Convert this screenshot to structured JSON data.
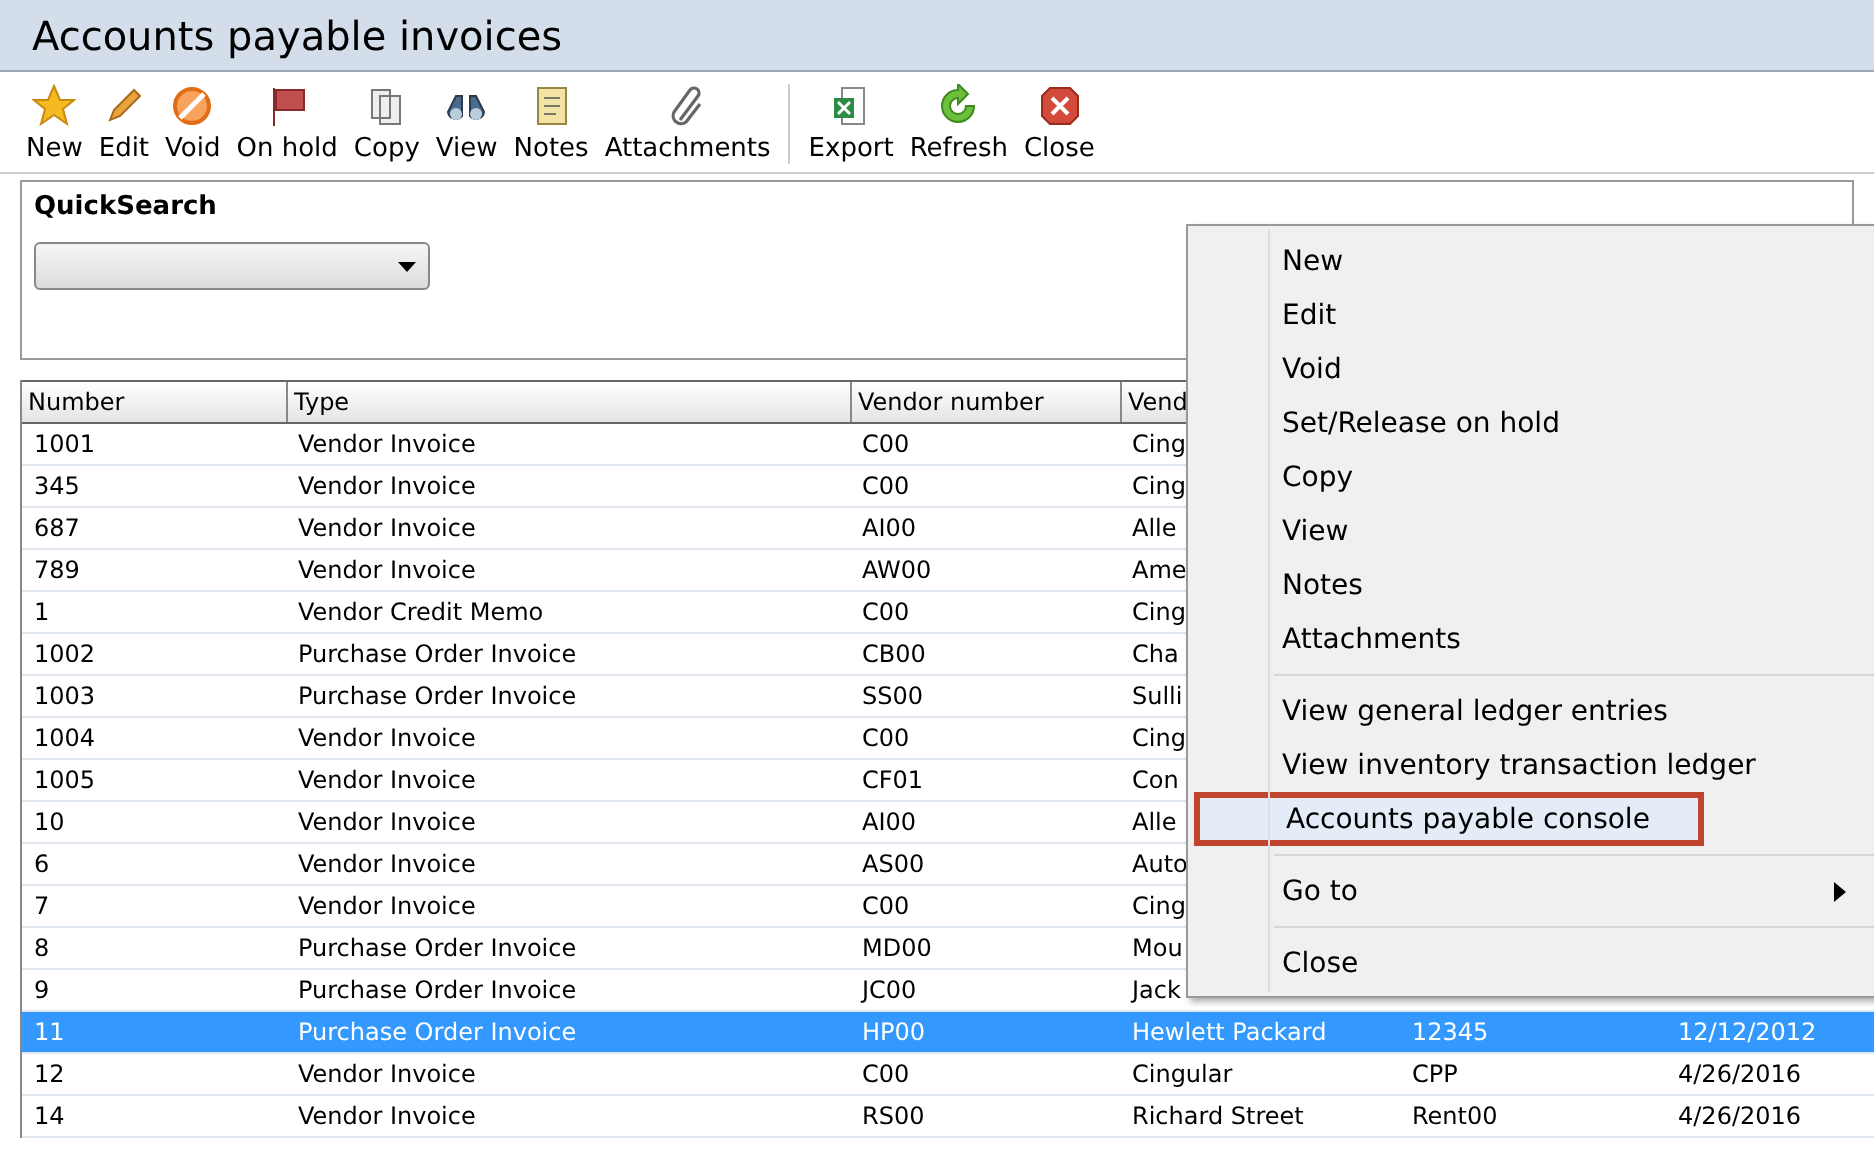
{
  "window": {
    "title": "Accounts payable invoices"
  },
  "toolbar": {
    "groups": [
      [
        {
          "label": "New",
          "kind": "star"
        },
        {
          "label": "Edit",
          "kind": "pencil"
        },
        {
          "label": "Void",
          "kind": "void"
        },
        {
          "label": "On hold",
          "kind": "flag"
        },
        {
          "label": "Copy",
          "kind": "copy"
        },
        {
          "label": "View",
          "kind": "binoculars"
        },
        {
          "label": "Notes",
          "kind": "notes"
        },
        {
          "label": "Attachments",
          "kind": "clip"
        }
      ],
      [
        {
          "label": "Export",
          "kind": "sheet"
        },
        {
          "label": "Refresh",
          "kind": "refresh"
        },
        {
          "label": "Close",
          "kind": "close"
        }
      ]
    ]
  },
  "quick_search": {
    "label": "QuickSearch"
  },
  "table": {
    "columns": [
      "Number",
      "Type",
      "Vendor number",
      "Vend"
    ],
    "rows": [
      {
        "selected": false,
        "cells": [
          "1001",
          "Vendor Invoice",
          "C00",
          "Cing"
        ]
      },
      {
        "selected": false,
        "cells": [
          "345",
          "Vendor Invoice",
          "C00",
          "Cing"
        ]
      },
      {
        "selected": false,
        "cells": [
          "687",
          "Vendor Invoice",
          "AI00",
          "Alle"
        ]
      },
      {
        "selected": false,
        "cells": [
          "789",
          "Vendor Invoice",
          "AW00",
          "Ame"
        ]
      },
      {
        "selected": false,
        "cells": [
          "1",
          "Vendor Credit Memo",
          "C00",
          "Cing"
        ]
      },
      {
        "selected": false,
        "cells": [
          "1002",
          "Purchase Order Invoice",
          "CB00",
          "Cha"
        ]
      },
      {
        "selected": false,
        "cells": [
          "1003",
          "Purchase Order Invoice",
          "SS00",
          "Sulli"
        ]
      },
      {
        "selected": false,
        "cells": [
          "1004",
          "Vendor Invoice",
          "C00",
          "Cing"
        ]
      },
      {
        "selected": false,
        "cells": [
          "1005",
          "Vendor Invoice",
          "CF01",
          "Con"
        ]
      },
      {
        "selected": false,
        "cells": [
          "10",
          "Vendor Invoice",
          "AI00",
          "Alle"
        ]
      },
      {
        "selected": false,
        "cells": [
          "6",
          "Vendor Invoice",
          "AS00",
          "Auto"
        ]
      },
      {
        "selected": false,
        "cells": [
          "7",
          "Vendor Invoice",
          "C00",
          "Cing"
        ]
      },
      {
        "selected": false,
        "cells": [
          "8",
          "Purchase Order Invoice",
          "MD00",
          "Mou"
        ]
      },
      {
        "selected": false,
        "cells": [
          "9",
          "Purchase Order Invoice",
          "JC00",
          "Jack"
        ]
      },
      {
        "selected": true,
        "cells": [
          "11",
          "Purchase Order Invoice",
          "HP00",
          "Hewlett Packard",
          "12345",
          "12/12/2012"
        ]
      },
      {
        "selected": false,
        "cells": [
          "12",
          "Vendor Invoice",
          "C00",
          "Cingular",
          "CPP",
          "4/26/2016"
        ]
      },
      {
        "selected": false,
        "cells": [
          "14",
          "Vendor Invoice",
          "RS00",
          "Richard Street",
          "Rent00",
          "4/26/2016"
        ]
      }
    ]
  },
  "context_menu": {
    "sections": [
      [
        {
          "label": "New",
          "selected": false
        },
        {
          "label": "Edit",
          "selected": false
        },
        {
          "label": "Void",
          "selected": false
        },
        {
          "label": "Set/Release on hold",
          "selected": false
        },
        {
          "label": "Copy",
          "selected": false
        },
        {
          "label": "View",
          "selected": false
        },
        {
          "label": "Notes",
          "selected": false
        },
        {
          "label": "Attachments",
          "selected": false
        }
      ],
      [
        {
          "label": "View general ledger entries",
          "selected": false
        },
        {
          "label": "View inventory transaction ledger",
          "selected": false
        },
        {
          "label": "Accounts payable console",
          "selected": true
        }
      ],
      [
        {
          "label": "Go to",
          "selected": false,
          "submenu": true
        }
      ],
      [
        {
          "label": "Close",
          "selected": false
        }
      ]
    ]
  }
}
